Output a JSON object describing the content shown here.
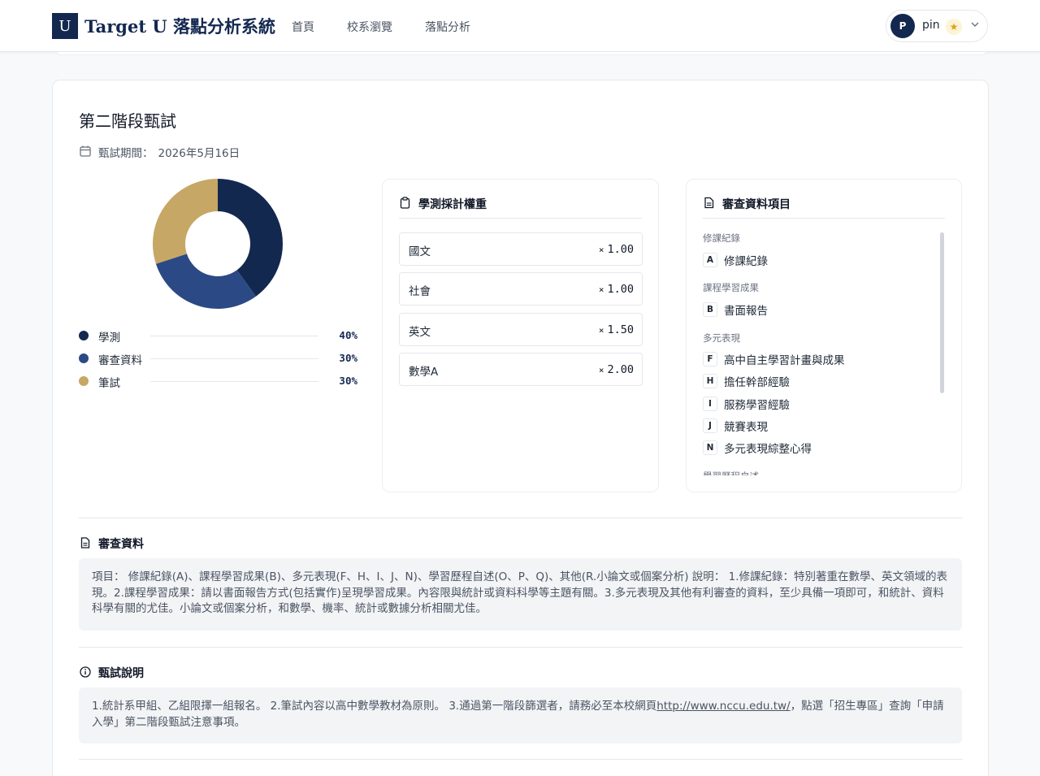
{
  "app": {
    "logo_letter": "U",
    "brand": "Target U 落點分析系統"
  },
  "nav": [
    {
      "label": "首頁"
    },
    {
      "label": "校系瀏覽"
    },
    {
      "label": "落點分析"
    }
  ],
  "user": {
    "initial": "P",
    "name": "pin",
    "badge_icon": "star-icon"
  },
  "stage": {
    "title": "第二階段甄試",
    "period_label": "甄試期間：",
    "period_value": "2026年5月16日"
  },
  "chart_data": {
    "type": "pie",
    "donut": true,
    "slices": [
      {
        "label": "學測",
        "value": 40,
        "display": "40%",
        "color": "#13284f"
      },
      {
        "label": "審查資料",
        "value": 30,
        "display": "30%",
        "color": "#2b4a85"
      },
      {
        "label": "筆試",
        "value": 30,
        "display": "30%",
        "color": "#c6a765"
      }
    ]
  },
  "weights": {
    "title": "學測採計權重",
    "multiplier": "×",
    "items": [
      {
        "subject": "國文",
        "value": "1.00"
      },
      {
        "subject": "社會",
        "value": "1.00"
      },
      {
        "subject": "英文",
        "value": "1.50"
      },
      {
        "subject": "數學A",
        "value": "2.00"
      }
    ]
  },
  "review_items": {
    "title": "審查資料項目",
    "groups": [
      {
        "name": "修課紀錄",
        "items": [
          {
            "code": "A",
            "label": "修課紀錄"
          }
        ]
      },
      {
        "name": "課程學習成果",
        "items": [
          {
            "code": "B",
            "label": "書面報告"
          }
        ]
      },
      {
        "name": "多元表現",
        "items": [
          {
            "code": "F",
            "label": "高中自主學習計畫與成果"
          },
          {
            "code": "H",
            "label": "擔任幹部經驗"
          },
          {
            "code": "I",
            "label": "服務學習經驗"
          },
          {
            "code": "J",
            "label": "競賽表現"
          },
          {
            "code": "N",
            "label": "多元表現綜整心得"
          }
        ]
      },
      {
        "name": "學習歷程自述",
        "items": []
      }
    ]
  },
  "review_section": {
    "title": "審查資料",
    "text": "項目： 修課紀錄(A)、課程學習成果(B)、多元表現(F、H、I、J、N)、學習歷程自述(O、P、Q)、其他(R.小論文或個案分析) 說明： 1.修課紀錄：特別著重在數學、英文領域的表現。2.課程學習成果：請以書面報告方式(包括實作)呈現學習成果。內容限與統計或資料科學等主題有關。3.多元表現及其他有利審查的資料，至少具備一項即可，和統計、資料科學有關的尤佳。小論文或個案分析，和數學、機率、統計或數據分析相關尤佳。"
  },
  "exam_section": {
    "title": "甄試說明",
    "text_before": "1.統計系甲組、乙組限擇一組報名。 2.筆試內容以高中數學教材為原則。 3.通過第一階段篩選者，請務必至本校網頁",
    "link": "http://www.nccu.edu.tw/",
    "text_after": "，點選「招生專區」查詢「申請入學」第二階段甄試注意事項。"
  }
}
